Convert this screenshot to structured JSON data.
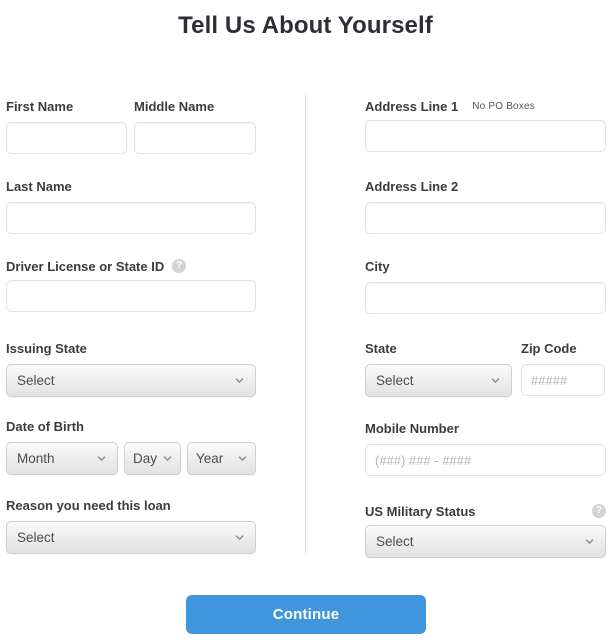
{
  "page": {
    "title": "Tell Us About Yourself",
    "accent_color": "#3f96dd",
    "label_color": "#3b3b42",
    "divider_color": "#dcdcdc"
  },
  "left_column": {
    "first_name": {
      "label": "First Name",
      "value": "",
      "placeholder": ""
    },
    "middle_name": {
      "label": "Middle Name",
      "value": "",
      "placeholder": ""
    },
    "last_name": {
      "label": "Last Name",
      "value": "",
      "placeholder": ""
    },
    "driver_license": {
      "label": "Driver License or State ID",
      "value": "",
      "placeholder": "",
      "help_icon": "question-mark-icon",
      "help_glyph": "?"
    },
    "issuing_state": {
      "label": "Issuing State",
      "selected": "Select"
    },
    "date_of_birth": {
      "label": "Date of Birth",
      "month": "Month",
      "day": "Day",
      "year": "Year"
    },
    "loan_reason": {
      "label": "Reason you need this loan",
      "selected": "Select"
    }
  },
  "right_column": {
    "address_line_1": {
      "label": "Address Line 1",
      "hint": "No PO Boxes",
      "value": "",
      "placeholder": ""
    },
    "address_line_2": {
      "label": "Address Line 2",
      "value": "",
      "placeholder": ""
    },
    "city": {
      "label": "City",
      "value": "",
      "placeholder": ""
    },
    "state": {
      "label": "State",
      "selected": "Select"
    },
    "zip_code": {
      "label": "Zip Code",
      "value": "",
      "placeholder": "#####"
    },
    "mobile_number": {
      "label": "Mobile Number",
      "value": "",
      "placeholder": "(###) ### - ####"
    },
    "military_status": {
      "label": "US Military Status",
      "selected": "Select",
      "help_icon": "question-mark-icon",
      "help_glyph": "?"
    }
  },
  "footer": {
    "continue_label": "Continue"
  }
}
